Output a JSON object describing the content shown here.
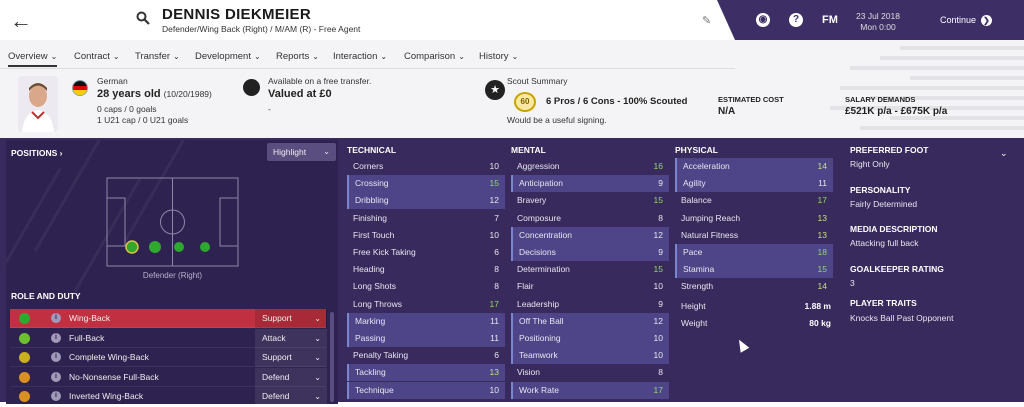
{
  "header": {
    "player_name": "DENNIS DIEKMEIER",
    "positions_line": "Defender/Wing Back (Right) / M/AM (R) - Free Agent",
    "fm_label": "FM",
    "date": "23 Jul 2018",
    "time": "Mon 0:00",
    "continue_label": "Continue"
  },
  "tabs": [
    {
      "label": "Overview"
    },
    {
      "label": "Contract"
    },
    {
      "label": "Transfer"
    },
    {
      "label": "Development"
    },
    {
      "label": "Reports"
    },
    {
      "label": "Interaction"
    },
    {
      "label": "Comparison"
    },
    {
      "label": "History"
    }
  ],
  "profile": {
    "nationality": "German",
    "age_main": "28 years old",
    "dob": "(10/20/1989)",
    "caps": "0 caps / 0 goals",
    "u21": "1 U21 cap / 0 U21 goals",
    "availability": "Available on a free transfer.",
    "valued": "Valued at £0",
    "valued_sub": "-",
    "scout_title": "Scout Summary",
    "scout_score": "60",
    "scout_line": "6 Pros / 6 Cons - 100% Scouted",
    "scout_note": "Would be a useful signing.",
    "est_cost_label": "ESTIMATED COST",
    "est_cost_value": "N/A",
    "salary_label": "SALARY DEMANDS",
    "salary_value": "£521K p/a - £675K p/a"
  },
  "positions_panel": {
    "title": "POSITIONS",
    "title_arrow": "›",
    "highlight_label": "Highlight",
    "pitch_label": "Defender (Right)",
    "role_title": "ROLE AND DUTY",
    "roles": [
      {
        "name": "Wing-Back",
        "duty": "Support",
        "dot_color": "#2fa82f",
        "selected": true
      },
      {
        "name": "Full-Back",
        "duty": "Attack",
        "dot_color": "#6cc02e",
        "selected": false
      },
      {
        "name": "Complete Wing-Back",
        "duty": "Support",
        "dot_color": "#c8b020",
        "selected": false
      },
      {
        "name": "No-Nonsense Full-Back",
        "duty": "Defend",
        "dot_color": "#d89020",
        "selected": false
      },
      {
        "name": "Inverted Wing-Back",
        "duty": "Defend",
        "dot_color": "#d89020",
        "selected": false
      }
    ]
  },
  "technical": {
    "title": "TECHNICAL",
    "attrs": [
      {
        "name": "Corners",
        "value": "10",
        "hl": false
      },
      {
        "name": "Crossing",
        "value": "15",
        "hl": true
      },
      {
        "name": "Dribbling",
        "value": "12",
        "hl": true
      },
      {
        "name": "Finishing",
        "value": "7",
        "hl": false
      },
      {
        "name": "First Touch",
        "value": "10",
        "hl": false
      },
      {
        "name": "Free Kick Taking",
        "value": "6",
        "hl": false
      },
      {
        "name": "Heading",
        "value": "8",
        "hl": false
      },
      {
        "name": "Long Shots",
        "value": "8",
        "hl": false
      },
      {
        "name": "Long Throws",
        "value": "17",
        "hl": false
      },
      {
        "name": "Marking",
        "value": "11",
        "hl": true
      },
      {
        "name": "Passing",
        "value": "11",
        "hl": true
      },
      {
        "name": "Penalty Taking",
        "value": "6",
        "hl": false
      },
      {
        "name": "Tackling",
        "value": "13",
        "hl": true
      },
      {
        "name": "Technique",
        "value": "10",
        "hl": true
      }
    ]
  },
  "mental": {
    "title": "MENTAL",
    "attrs": [
      {
        "name": "Aggression",
        "value": "16",
        "hl": false
      },
      {
        "name": "Anticipation",
        "value": "9",
        "hl": true
      },
      {
        "name": "Bravery",
        "value": "15",
        "hl": false
      },
      {
        "name": "Composure",
        "value": "8",
        "hl": false
      },
      {
        "name": "Concentration",
        "value": "12",
        "hl": true
      },
      {
        "name": "Decisions",
        "value": "9",
        "hl": true
      },
      {
        "name": "Determination",
        "value": "15",
        "hl": false
      },
      {
        "name": "Flair",
        "value": "10",
        "hl": false
      },
      {
        "name": "Leadership",
        "value": "9",
        "hl": false
      },
      {
        "name": "Off The Ball",
        "value": "12",
        "hl": true
      },
      {
        "name": "Positioning",
        "value": "10",
        "hl": true
      },
      {
        "name": "Teamwork",
        "value": "10",
        "hl": true
      },
      {
        "name": "Vision",
        "value": "8",
        "hl": false
      },
      {
        "name": "Work Rate",
        "value": "17",
        "hl": true
      }
    ]
  },
  "physical": {
    "title": "PHYSICAL",
    "attrs": [
      {
        "name": "Acceleration",
        "value": "14",
        "hl": true
      },
      {
        "name": "Agility",
        "value": "11",
        "hl": true
      },
      {
        "name": "Balance",
        "value": "17",
        "hl": false
      },
      {
        "name": "Jumping Reach",
        "value": "13",
        "hl": false
      },
      {
        "name": "Natural Fitness",
        "value": "13",
        "hl": false
      },
      {
        "name": "Pace",
        "value": "18",
        "hl": true
      },
      {
        "name": "Stamina",
        "value": "15",
        "hl": true
      },
      {
        "name": "Strength",
        "value": "14",
        "hl": false
      }
    ],
    "height_label": "Height",
    "height_value": "1.88 m",
    "weight_label": "Weight",
    "weight_value": "80 kg"
  },
  "info": {
    "preferred_foot_label": "PREFERRED FOOT",
    "preferred_foot": "Right Only",
    "personality_label": "PERSONALITY",
    "personality": "Fairly Determined",
    "media_label": "MEDIA DESCRIPTION",
    "media": "Attacking full back",
    "gk_label": "GOALKEEPER RATING",
    "gk": "3",
    "traits_label": "PLAYER TRAITS",
    "traits": "Knocks Ball Past Opponent"
  },
  "colors": {
    "panel_bg": "#392a5e",
    "highlight_row": "#4d4588",
    "selected_role": "#c03040",
    "good_value": "#8fd86a"
  }
}
